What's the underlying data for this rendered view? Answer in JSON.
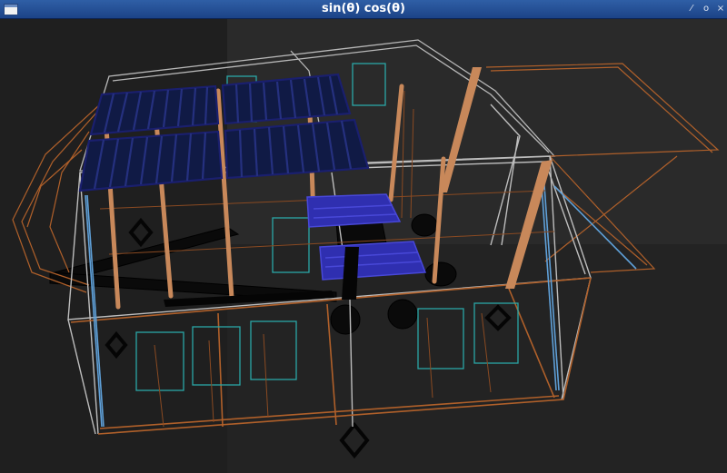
{
  "window": {
    "title": "sin(θ) cos(θ)",
    "buttons": {
      "minimize": "⁄",
      "maximize": "o",
      "close": "×"
    }
  },
  "scene": {
    "background": "#1e1e1e",
    "colors": {
      "orange": "#b0602a",
      "orange_fill": "#c8885a",
      "gray": "#b8b8b8",
      "cyan": "#2aa7a7",
      "blue": "#5fa0d8",
      "navy": "#1a1f6e",
      "solar_fill": "#101a45",
      "seat": "#2f2fb0"
    }
  }
}
